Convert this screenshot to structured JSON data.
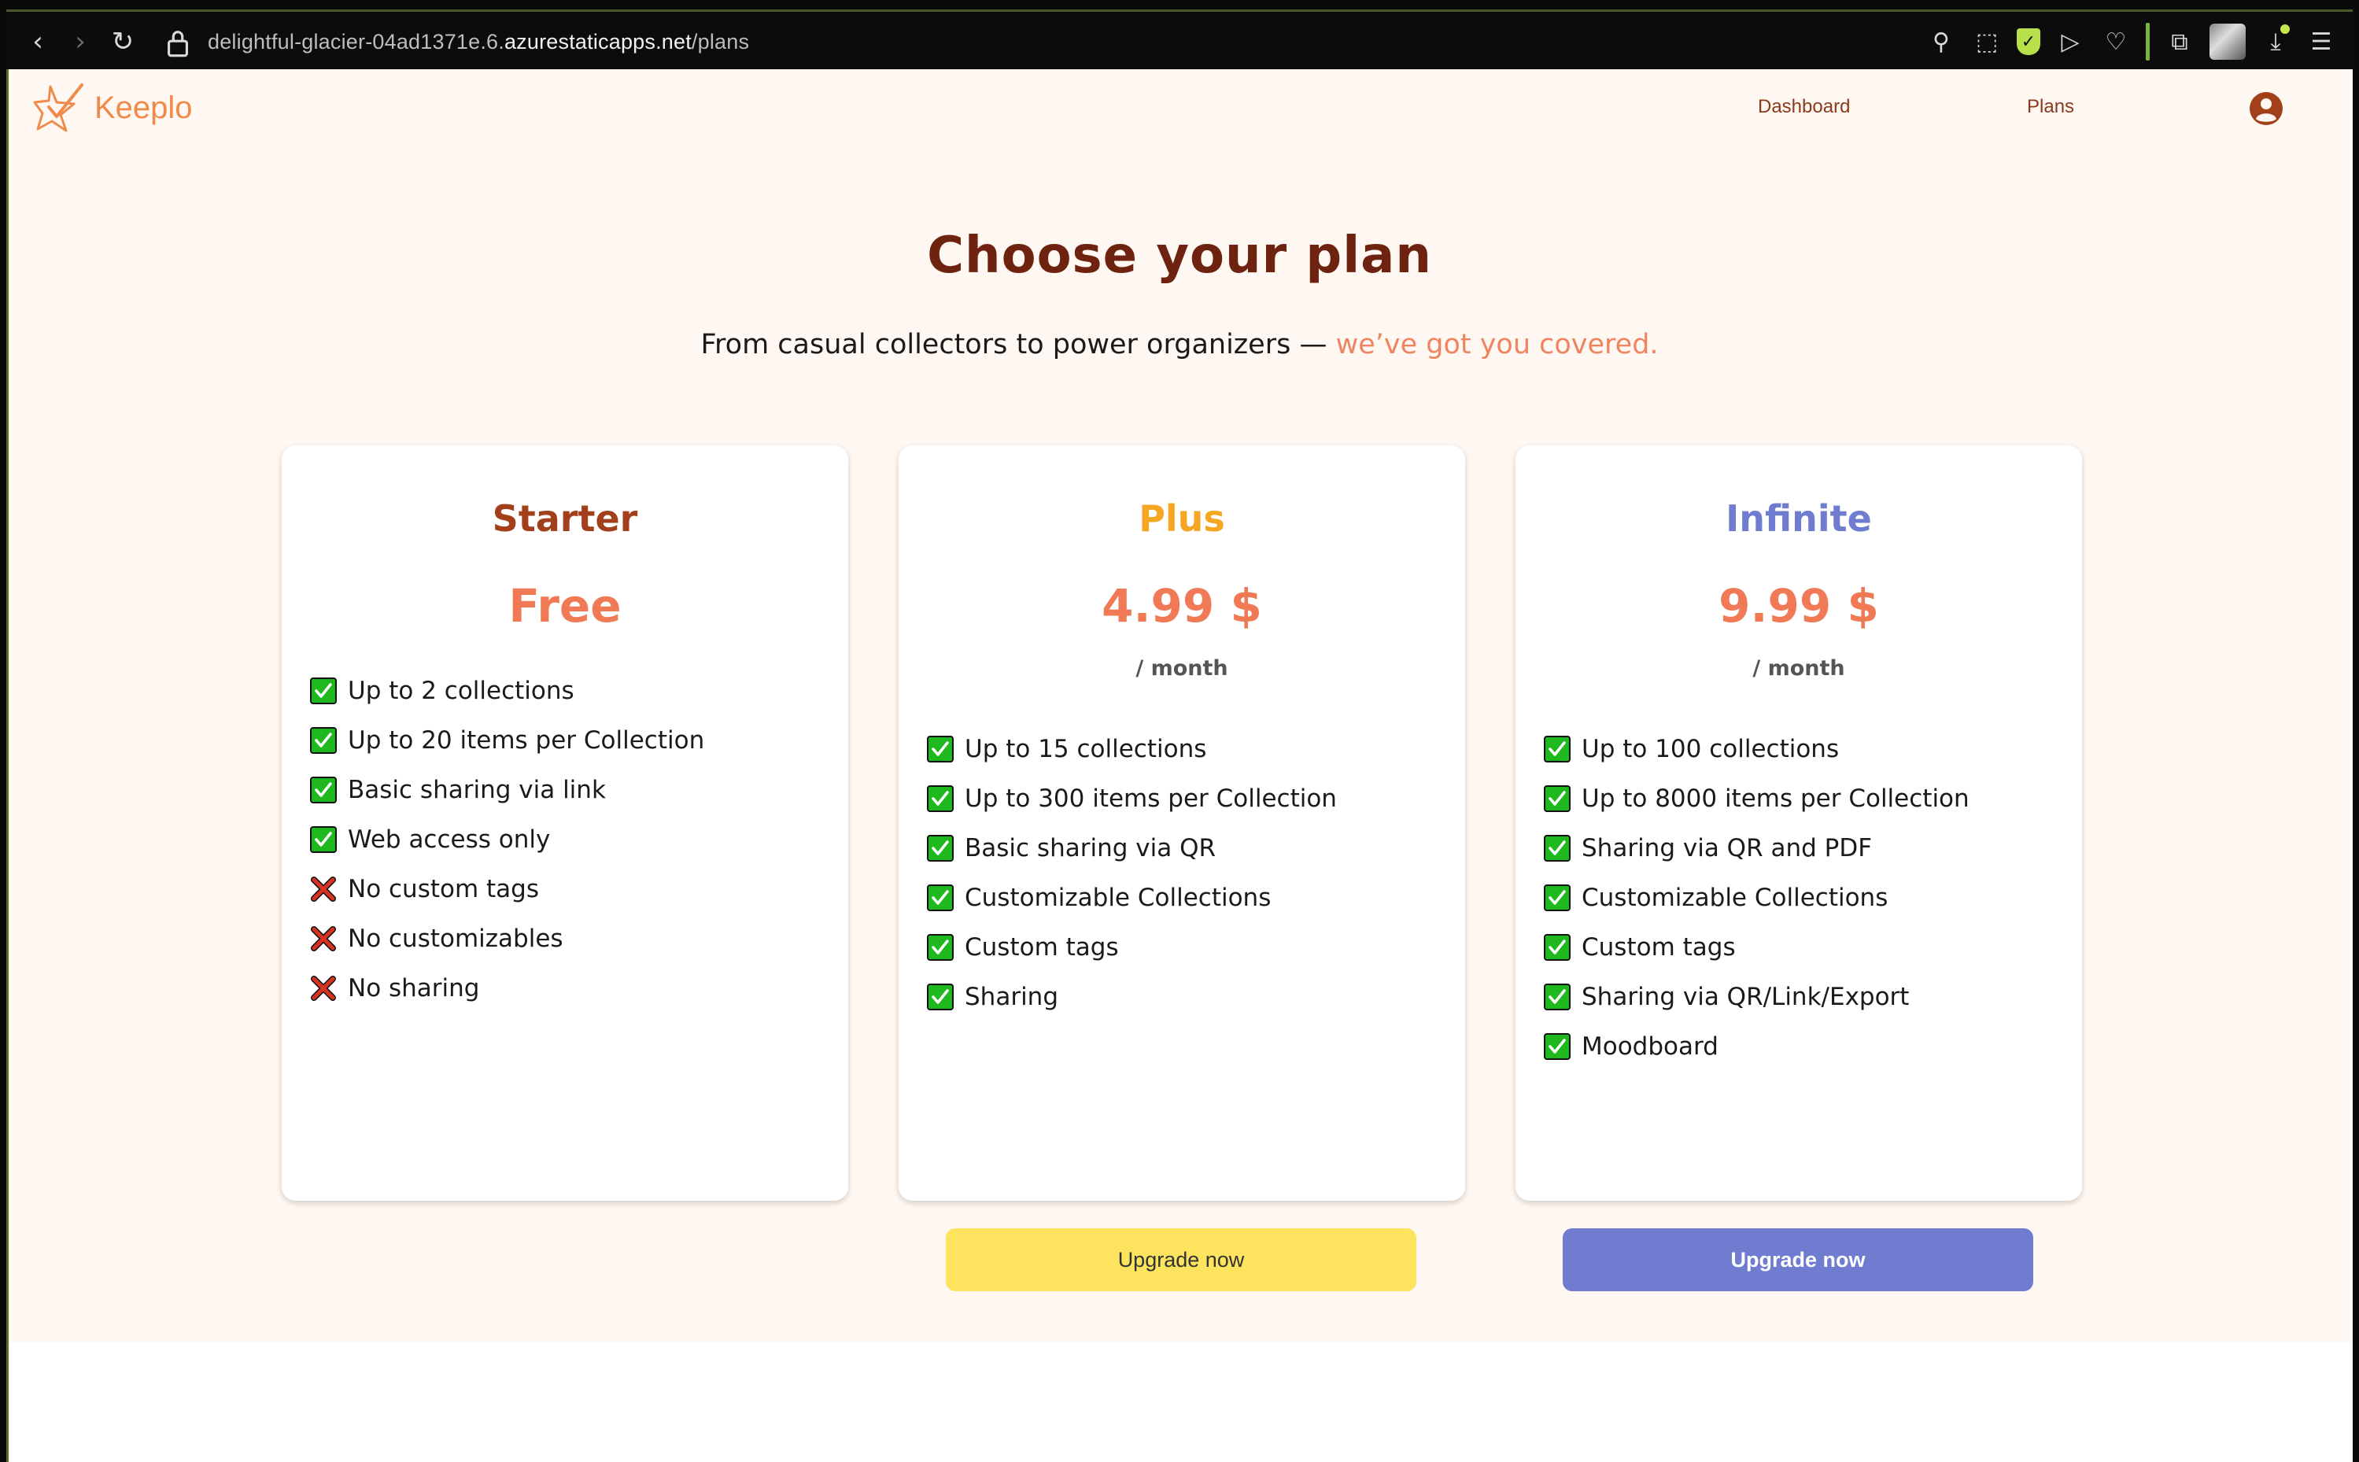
{
  "browser": {
    "url_prefix": "delightful-glacier-04ad1371e.6.",
    "url_host": "azurestaticapps.net",
    "url_path": "/plans"
  },
  "header": {
    "logo_text": "Keeplo",
    "nav": {
      "dashboard": "Dashboard",
      "plans": "Plans"
    }
  },
  "main": {
    "title": "Choose your plan",
    "subtitle_main": "From casual collectors to power organizers — ",
    "subtitle_accent": "we’ve got you covered."
  },
  "plans": [
    {
      "name": "Starter",
      "price": "Free",
      "period": "",
      "name_color": "#a2401c",
      "features": [
        {
          "text": "Up to 2 collections",
          "included": true
        },
        {
          "text": "Up to 20 items per Collection",
          "included": true
        },
        {
          "text": "Basic sharing via link",
          "included": true
        },
        {
          "text": "Web access only",
          "included": true
        },
        {
          "text": "No custom tags",
          "included": false
        },
        {
          "text": "No customizables",
          "included": false
        },
        {
          "text": "No sharing",
          "included": false
        }
      ]
    },
    {
      "name": "Plus",
      "price": "4.99 $",
      "period": "/ month",
      "name_color": "#f5a623",
      "features": [
        {
          "text": "Up to 15 collections",
          "included": true
        },
        {
          "text": "Up to 300 items per Collection",
          "included": true
        },
        {
          "text": "Basic sharing via QR",
          "included": true
        },
        {
          "text": "Customizable Collections",
          "included": true
        },
        {
          "text": "Custom tags",
          "included": true
        },
        {
          "text": "Sharing",
          "included": true
        }
      ],
      "button": "Upgrade now"
    },
    {
      "name": "Infinite",
      "price": "9.99 $",
      "period": "/ month",
      "name_color": "#6f7ccf",
      "features": [
        {
          "text": "Up to 100 collections",
          "included": true
        },
        {
          "text": "Up to 8000 items per Collection",
          "included": true
        },
        {
          "text": "Sharing via QR and PDF",
          "included": true
        },
        {
          "text": "Customizable Collections",
          "included": true
        },
        {
          "text": "Custom tags",
          "included": true
        },
        {
          "text": "Sharing via QR/Link/Export",
          "included": true
        },
        {
          "text": "Moodboard",
          "included": true
        }
      ],
      "button": "Upgrade now"
    }
  ],
  "colors": {
    "accent": "#ef7a55",
    "background": "#fff8f2",
    "check": "#1fb91f",
    "cross": "#d6321f"
  }
}
